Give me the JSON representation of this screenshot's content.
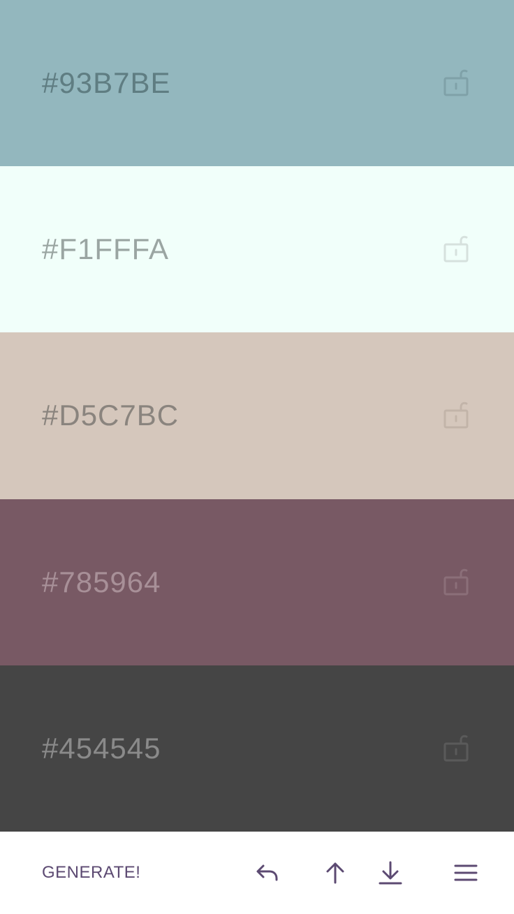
{
  "palette": {
    "swatches": [
      {
        "hex": "#93B7BE",
        "bg": "#93b7be",
        "text_color": "#5f7d82",
        "lock_color": "#7fa1a8"
      },
      {
        "hex": "#F1FFFA",
        "bg": "#f1fffa",
        "text_color": "#9aa5a2",
        "lock_color": "#d6e1dd"
      },
      {
        "hex": "#D5C7BC",
        "bg": "#d5c7bc",
        "text_color": "#8a847e",
        "lock_color": "#c2b4a9"
      },
      {
        "hex": "#785964",
        "bg": "#785964",
        "text_color": "#a89098",
        "lock_color": "#8b6f79"
      },
      {
        "hex": "#454545",
        "bg": "#454545",
        "text_color": "#8a8a8a",
        "lock_color": "#5a5a5a"
      }
    ],
    "lock_icon": "unlocked-padlock-icon"
  },
  "toolbar": {
    "generate_label": "GENERATE!",
    "accent_color": "#5c4a72",
    "icons": [
      "undo-icon",
      "upload-icon",
      "download-icon",
      "menu-icon"
    ]
  }
}
